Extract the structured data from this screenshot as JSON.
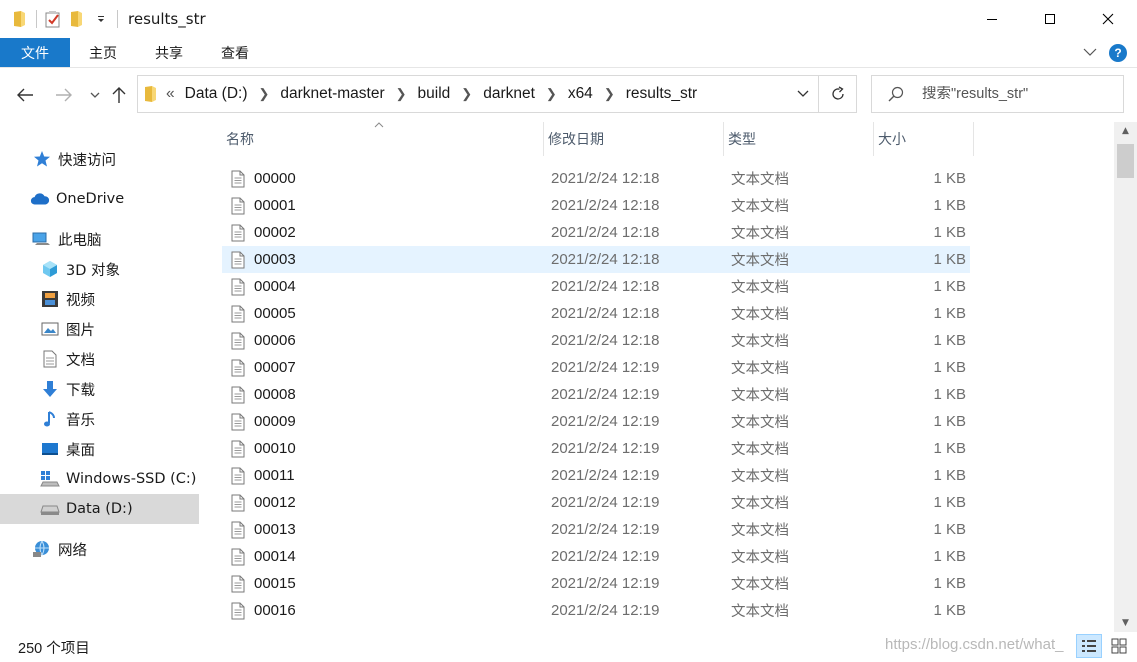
{
  "window": {
    "title": "results_str",
    "controls": [
      "minimize",
      "maximize",
      "close"
    ]
  },
  "ribbon": {
    "tabs": [
      "文件",
      "主页",
      "共享",
      "查看"
    ],
    "active_tab": "文件"
  },
  "address": {
    "overflow": "«",
    "crumbs": [
      "Data (D:)",
      "darknet-master",
      "build",
      "darknet",
      "x64",
      "results_str"
    ]
  },
  "search": {
    "placeholder": "搜索\"results_str\""
  },
  "sidebar": {
    "items": [
      {
        "label": "快速访问",
        "icon": "star-icon",
        "level": 0
      },
      {
        "label": "OneDrive",
        "icon": "cloud-icon",
        "level": 0
      },
      {
        "label": "此电脑",
        "icon": "computer-icon",
        "level": 0
      },
      {
        "label": "3D 对象",
        "icon": "cube-icon",
        "level": 1
      },
      {
        "label": "视频",
        "icon": "film-icon",
        "level": 1
      },
      {
        "label": "图片",
        "icon": "picture-icon",
        "level": 1
      },
      {
        "label": "文档",
        "icon": "document-icon",
        "level": 1
      },
      {
        "label": "下载",
        "icon": "download-icon",
        "level": 1
      },
      {
        "label": "音乐",
        "icon": "music-icon",
        "level": 1
      },
      {
        "label": "桌面",
        "icon": "desktop-icon",
        "level": 1
      },
      {
        "label": "Windows-SSD (C:)",
        "icon": "windows-drive-icon",
        "level": 1
      },
      {
        "label": "Data (D:)",
        "icon": "drive-icon",
        "level": 1,
        "selected": true
      },
      {
        "label": "网络",
        "icon": "network-icon",
        "level": 0
      }
    ]
  },
  "columns": [
    "名称",
    "修改日期",
    "类型",
    "大小"
  ],
  "files": [
    {
      "name": "00000",
      "date": "2021/2/24 12:18",
      "type": "文本文档",
      "size": "1 KB"
    },
    {
      "name": "00001",
      "date": "2021/2/24 12:18",
      "type": "文本文档",
      "size": "1 KB"
    },
    {
      "name": "00002",
      "date": "2021/2/24 12:18",
      "type": "文本文档",
      "size": "1 KB"
    },
    {
      "name": "00003",
      "date": "2021/2/24 12:18",
      "type": "文本文档",
      "size": "1 KB",
      "hover": true
    },
    {
      "name": "00004",
      "date": "2021/2/24 12:18",
      "type": "文本文档",
      "size": "1 KB"
    },
    {
      "name": "00005",
      "date": "2021/2/24 12:18",
      "type": "文本文档",
      "size": "1 KB"
    },
    {
      "name": "00006",
      "date": "2021/2/24 12:18",
      "type": "文本文档",
      "size": "1 KB"
    },
    {
      "name": "00007",
      "date": "2021/2/24 12:19",
      "type": "文本文档",
      "size": "1 KB"
    },
    {
      "name": "00008",
      "date": "2021/2/24 12:19",
      "type": "文本文档",
      "size": "1 KB"
    },
    {
      "name": "00009",
      "date": "2021/2/24 12:19",
      "type": "文本文档",
      "size": "1 KB"
    },
    {
      "name": "00010",
      "date": "2021/2/24 12:19",
      "type": "文本文档",
      "size": "1 KB"
    },
    {
      "name": "00011",
      "date": "2021/2/24 12:19",
      "type": "文本文档",
      "size": "1 KB"
    },
    {
      "name": "00012",
      "date": "2021/2/24 12:19",
      "type": "文本文档",
      "size": "1 KB"
    },
    {
      "name": "00013",
      "date": "2021/2/24 12:19",
      "type": "文本文档",
      "size": "1 KB"
    },
    {
      "name": "00014",
      "date": "2021/2/24 12:19",
      "type": "文本文档",
      "size": "1 KB"
    },
    {
      "name": "00015",
      "date": "2021/2/24 12:19",
      "type": "文本文档",
      "size": "1 KB"
    },
    {
      "name": "00016",
      "date": "2021/2/24 12:19",
      "type": "文本文档",
      "size": "1 KB"
    }
  ],
  "status": {
    "count": "250 个项目",
    "watermark": "https://blog.csdn.net/what_"
  },
  "colors": {
    "accent": "#1979ca",
    "hover_row": "#e5f3ff",
    "selected_nav": "#d9d9d9",
    "folder": "#f8d775"
  }
}
